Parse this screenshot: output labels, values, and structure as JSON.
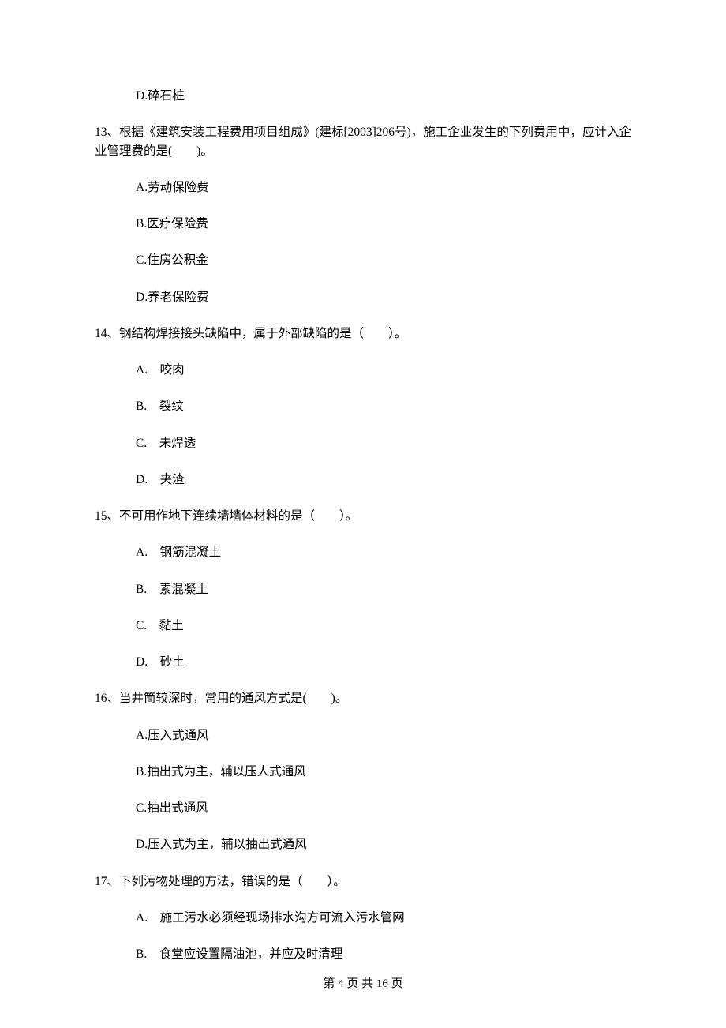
{
  "q12": {
    "optionD": "D.碎石桩"
  },
  "q13": {
    "stem": "13、根据《建筑安装工程费用项目组成》(建标[2003]206号)，施工企业发生的下列费用中，应计入企业管理费的是(　　)。",
    "A": "A.劳动保险费",
    "B": "B.医疗保险费",
    "C": "C.住房公积金",
    "D": "D.养老保险费"
  },
  "q14": {
    "stem": "14、钢结构焊接接头缺陷中，属于外部缺陷的是（　　）。",
    "A": "A.　咬肉",
    "B": "B.　裂纹",
    "C": "C.　未焊透",
    "D": "D.　夹渣"
  },
  "q15": {
    "stem": "15、不可用作地下连续墙墙体材料的是（　　）。",
    "A": "A.　钢筋混凝土",
    "B": "B.　素混凝土",
    "C": "C.　黏土",
    "D": "D.　砂土"
  },
  "q16": {
    "stem": "16、当井筒较深时，常用的通风方式是(　　)。",
    "A": "A.压入式通风",
    "B": "B.抽出式为主，辅以压人式通风",
    "C": "C.抽出式通风",
    "D": "D.压入式为主，辅以抽出式通风"
  },
  "q17": {
    "stem": "17、下列污物处理的方法，错误的是（　　）。",
    "A": "A.　施工污水必须经现场排水沟方可流入污水管网",
    "B": "B.　食堂应设置隔油池，并应及时清理"
  },
  "footer": "第 4 页 共 16 页"
}
